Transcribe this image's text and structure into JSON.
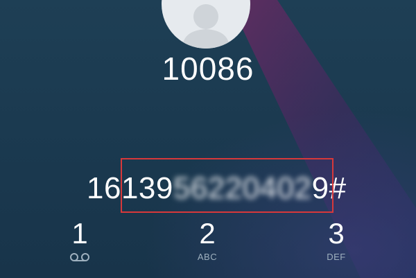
{
  "contact": {
    "name": "10086"
  },
  "dialer": {
    "visible_prefix": "16139",
    "masked_middle": "56220402",
    "visible_suffix": "9#"
  },
  "keypad": [
    {
      "digit": "1",
      "letters": "",
      "icon": "voicemail-icon"
    },
    {
      "digit": "2",
      "letters": "ABC"
    },
    {
      "digit": "3",
      "letters": "DEF"
    }
  ],
  "colors": {
    "background": "#1e3f55",
    "highlight_border": "#d8383a",
    "key_letters": "#9fb1bf",
    "beam": "#5a2a60"
  }
}
